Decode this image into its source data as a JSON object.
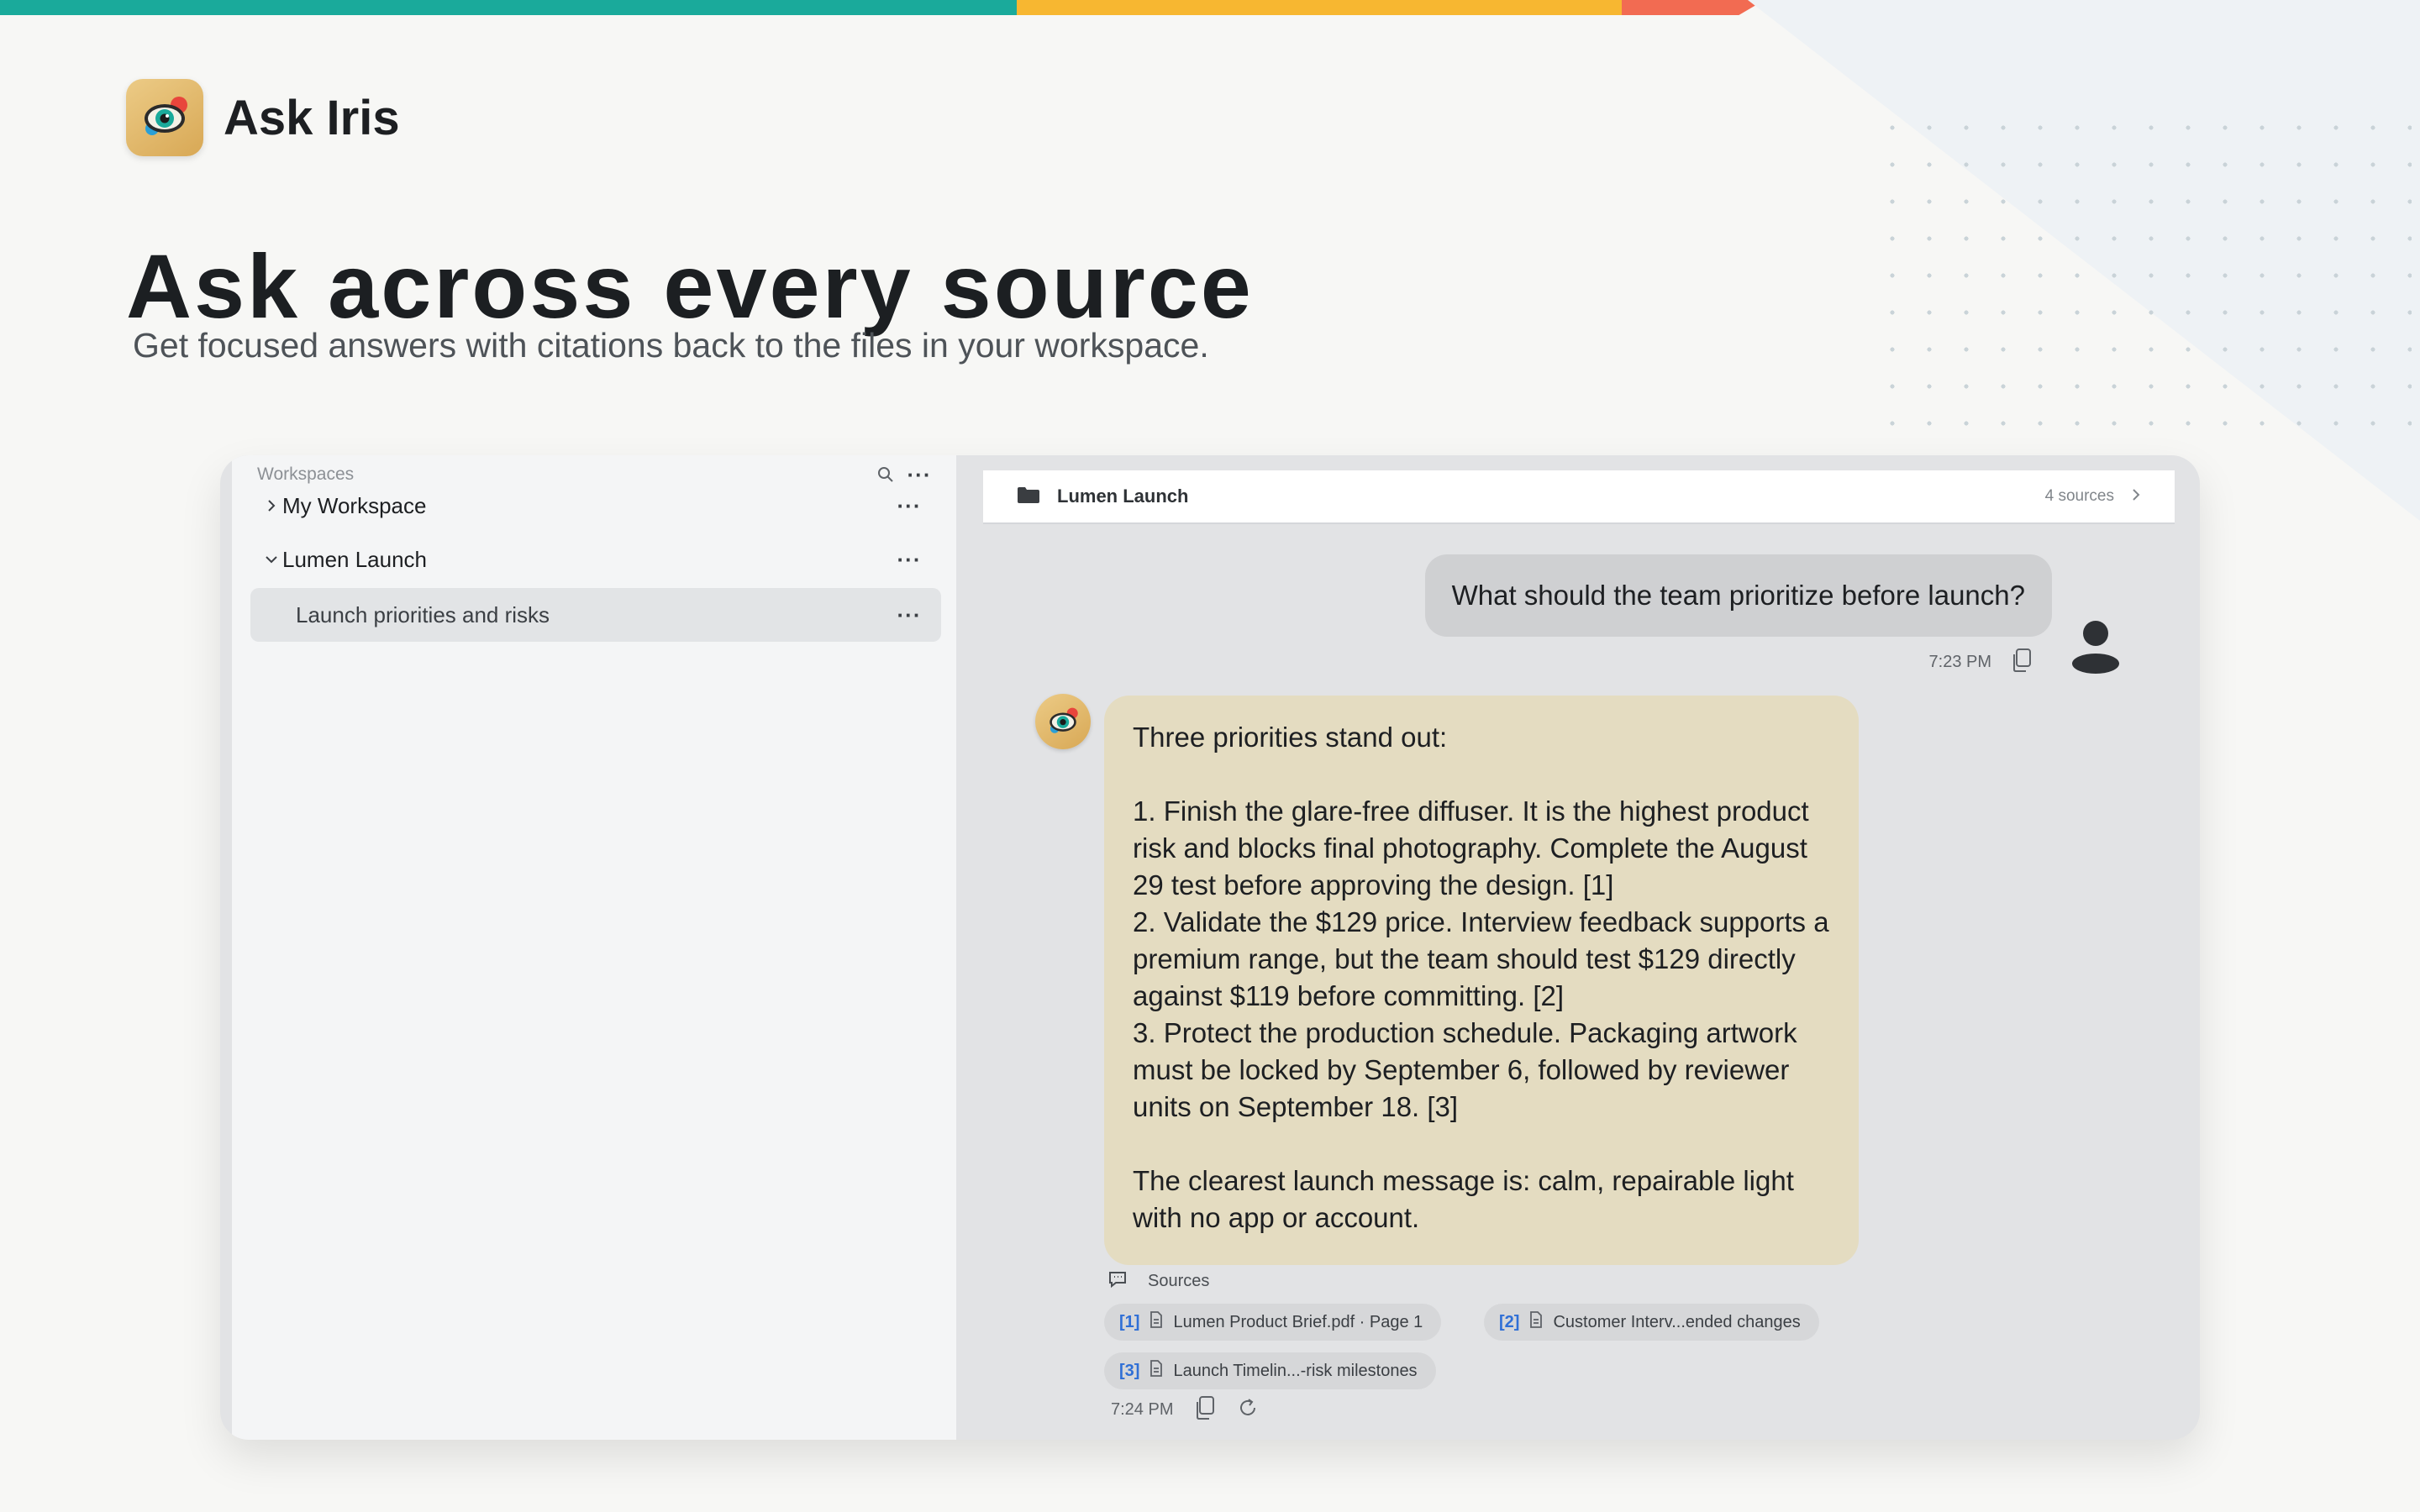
{
  "brand": {
    "app_name": "Ask Iris",
    "strip_colors": [
      "#1aaa9b",
      "#f7b731",
      "#f26b52"
    ]
  },
  "hero": {
    "headline": "Ask across every source",
    "subhead": "Get focused answers with citations back to the files in your workspace."
  },
  "sidebar": {
    "header_label": "Workspaces",
    "items": [
      {
        "label": "My Workspace",
        "expanded": false
      },
      {
        "label": "Lumen Launch",
        "expanded": true
      },
      {
        "label": "Launch priorities and risks",
        "selected": true
      }
    ]
  },
  "chat": {
    "header_title": "Lumen Launch",
    "source_count": "4 sources",
    "user_message": "What should the team prioritize before launch?",
    "user_time": "7:23 PM",
    "assistant": {
      "intro": "Three priorities stand out:",
      "points": [
        "1. Finish the glare-free diffuser. It is the highest product risk and blocks final photography. Complete the August 29 test before approving the design. [1]",
        "2. Validate the $129 price. Interview feedback supports a premium range, but the team should test $129 directly against $119 before committing. [2]",
        "3. Protect the production schedule. Packaging artwork must be locked by September 6, followed by reviewer units on September 18. [3]"
      ],
      "conclusion": "The clearest launch message is: calm, repairable light with no app or account.",
      "time": "7:24 PM"
    },
    "sources_label": "Sources",
    "sources": [
      {
        "ref": "[1]",
        "title": "Lumen Product Brief.pdf · Page 1"
      },
      {
        "ref": "[2]",
        "title": "Customer Interv...ended changes"
      },
      {
        "ref": "[3]",
        "title": "Launch Timelin...-risk milestones"
      }
    ]
  }
}
